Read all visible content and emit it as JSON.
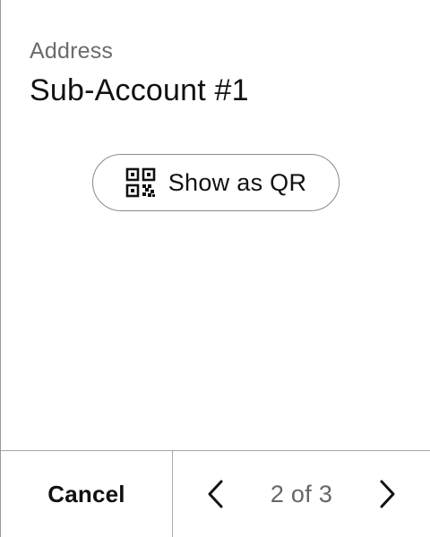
{
  "address": {
    "label": "Address",
    "account_name": "Sub-Account #1"
  },
  "qr_button": {
    "label": "Show as QR",
    "icon": "qr-code-icon"
  },
  "footer": {
    "cancel_label": "Cancel",
    "pager": {
      "text": "2 of 3",
      "current": 2,
      "total": 3,
      "prev_icon": "chevron-left-icon",
      "next_icon": "chevron-right-icon"
    }
  },
  "colors": {
    "text_primary": "#111111",
    "text_secondary": "#6b6b6b",
    "border": "#a8a8a8",
    "background": "#ffffff"
  }
}
